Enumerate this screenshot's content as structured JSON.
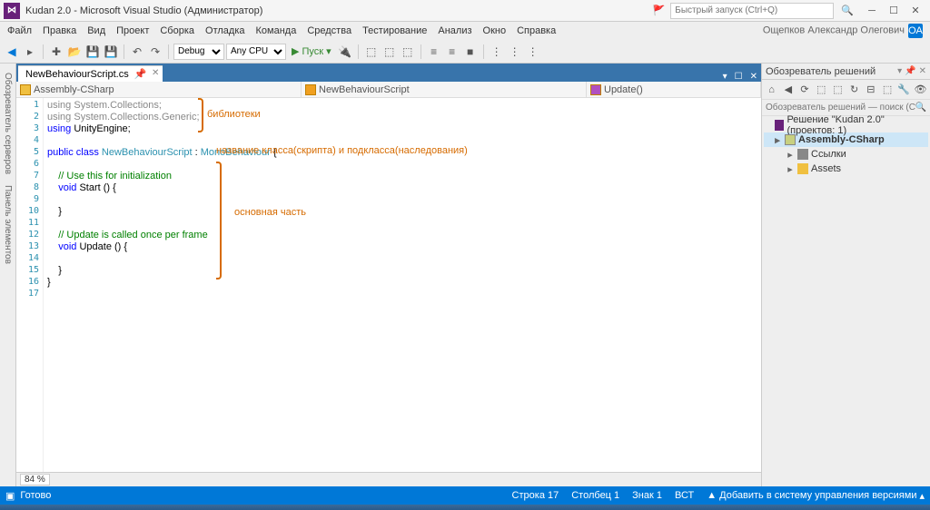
{
  "title": "Kudan 2.0 - Microsoft Visual Studio  (Администратор)",
  "quicklaunch_placeholder": "Быстрый запуск (Ctrl+Q)",
  "user": "Ощепков Александр Олегович",
  "user_initials": "ОА",
  "menu": [
    "Файл",
    "Правка",
    "Вид",
    "Проект",
    "Сборка",
    "Отладка",
    "Команда",
    "Средства",
    "Тестирование",
    "Анализ",
    "Окно",
    "Справка"
  ],
  "toolbar": {
    "config": "Debug",
    "platform": "Any CPU",
    "run": "Пуск"
  },
  "leftrail": [
    "Обозреватель серверов",
    "Панель элементов"
  ],
  "tab": "NewBehaviourScript.cs",
  "nav": {
    "scope": "Assembly-CSharp",
    "class": "NewBehaviourScript",
    "member": "Update()"
  },
  "lines": [
    "1",
    "2",
    "3",
    "4",
    "5",
    "6",
    "7",
    "8",
    "9",
    "10",
    "11",
    "12",
    "13",
    "14",
    "15",
    "16",
    "17"
  ],
  "code": {
    "l1a": "using",
    "l1b": " System.Collections;",
    "l2a": "using",
    "l2b": " System.Collections.Generic;",
    "l3a": "using",
    "l3b": " UnityEngine;",
    "l5a": "public class ",
    "l5b": "NewBehaviourScript",
    "l5c": " : ",
    "l5d": "MonoBehaviour",
    "l5e": " {",
    "l7": "    // Use this for initialization",
    "l8a": "    void",
    "l8b": " Start () {",
    "l10": "    }",
    "l12": "    // Update is called once per frame",
    "l13a": "    void",
    "l13b": " Update () {",
    "l15": "    }",
    "l16": "}"
  },
  "annot": {
    "lib": "библиотеки",
    "cls": "название класса(скрипта) и подкласса(наследования)",
    "main": "основная часть"
  },
  "zoom": "84 %",
  "solution": {
    "title": "Обозреватель решений",
    "search_placeholder": "Обозреватель решений — поиск (Ctrl+;)",
    "root": "Решение \"Kudan 2.0\" (проектов: 1)",
    "project": "Assembly-CSharp",
    "refs": "Ссылки",
    "assets": "Assets"
  },
  "status": {
    "ready": "Готово",
    "line": "Строка 17",
    "col": "Столбец 1",
    "char": "Знак 1",
    "ins": "ВСТ",
    "vc": "Добавить в систему управления версиями"
  }
}
